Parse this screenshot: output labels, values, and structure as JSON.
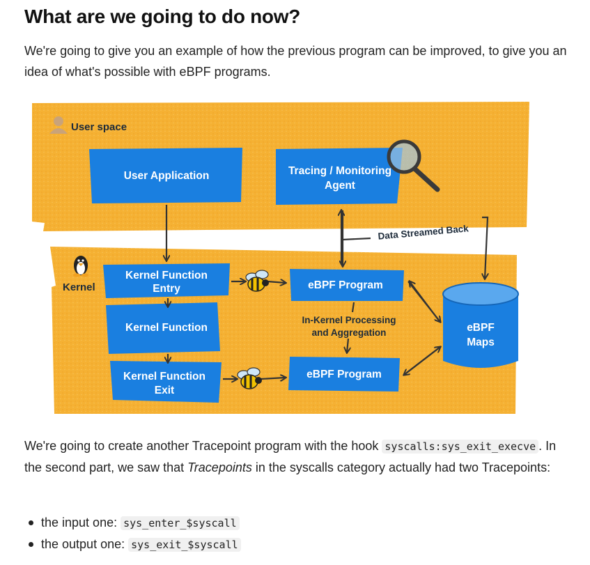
{
  "heading": "What are we going to do now?",
  "intro": "We're going to give you an example of how the previous program can be improved, to give you an idea of what's possible with eBPF programs.",
  "diagram": {
    "user_space_label": "User space",
    "kernel_label": "Kernel",
    "user_app": "User Application",
    "tracing_line1": "Tracing / Monitoring",
    "tracing_line2": "Agent",
    "data_streamed": "Data Streamed Back",
    "kf_entry_line1": "Kernel Function",
    "kf_entry_line2": "Entry",
    "kf_function": "Kernel Function",
    "kf_exit_line1": "Kernel Function",
    "kf_exit_line2": "Exit",
    "ebpf_program_top": "eBPF Program",
    "ebpf_program_bottom": "eBPF Program",
    "processing_line1": "In-Kernel Processing",
    "processing_line2": "and Aggregation",
    "maps_line1": "eBPF",
    "maps_line2": "Maps",
    "colors": {
      "background": "#f5b133",
      "box_blue": "#1a7fe0",
      "text_dark": "#1d2b3a"
    }
  },
  "after": {
    "part1": "We're going to create another Tracepoint program with the hook ",
    "code1": "syscalls:sys_exit_execve",
    "part2": ". In the second part, we saw that ",
    "em1": "Tracepoints",
    "part3": " in the syscalls category actually had two Tracepoints:"
  },
  "bullets": [
    {
      "text": "the input one: ",
      "code": "sys_enter_$syscall"
    },
    {
      "text": "the output one: ",
      "code": "sys_exit_$syscall"
    }
  ]
}
